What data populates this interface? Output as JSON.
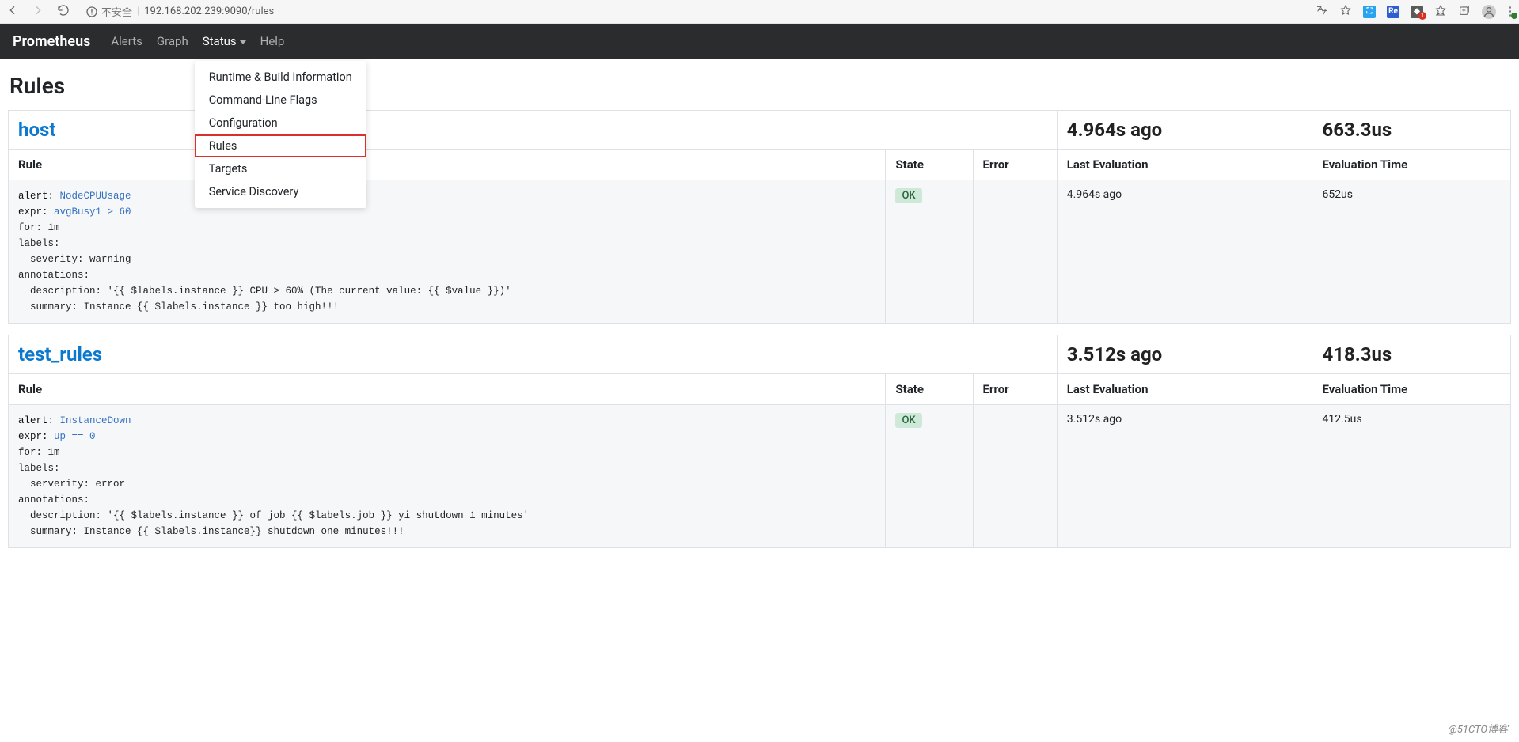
{
  "browser": {
    "insecure_label": "不安全",
    "url": "192.168.202.239:9090/rules"
  },
  "navbar": {
    "brand": "Prometheus",
    "items": {
      "alerts": "Alerts",
      "graph": "Graph",
      "status": "Status",
      "help": "Help"
    },
    "status_menu": {
      "runtime": "Runtime & Build Information",
      "flags": "Command-Line Flags",
      "configuration": "Configuration",
      "rules": "Rules",
      "targets": "Targets",
      "service_discovery": "Service Discovery"
    }
  },
  "page_title": "Rules",
  "columns": {
    "rule": "Rule",
    "state": "State",
    "error": "Error",
    "last_evaluation": "Last Evaluation",
    "evaluation_time": "Evaluation Time"
  },
  "groups": [
    {
      "name": "host",
      "last": "4.964s ago",
      "eval": "663.3us",
      "rules": [
        {
          "state": "OK",
          "error": "",
          "last": "4.964s ago",
          "eval": "652us",
          "code": {
            "alert_kw": "alert:",
            "alert_name": "NodeCPUUsage",
            "expr_kw": "expr:",
            "expr_body": "avgBusy1 > 60",
            "for_line": "for: 1m",
            "labels_line": "labels:",
            "labels_body": "  severity: warning",
            "annotations_line": "annotations:",
            "desc_line": "  description: '{{ $labels.instance }} CPU > 60% (The current value: {{ $value }})'",
            "summary_line": "  summary: Instance {{ $labels.instance }} too high!!!"
          }
        }
      ]
    },
    {
      "name": "test_rules",
      "last": "3.512s ago",
      "eval": "418.3us",
      "rules": [
        {
          "state": "OK",
          "error": "",
          "last": "3.512s ago",
          "eval": "412.5us",
          "code": {
            "alert_kw": "alert:",
            "alert_name": "InstanceDown",
            "expr_kw": "expr:",
            "expr_body": "up == 0",
            "for_line": "for: 1m",
            "labels_line": "labels:",
            "labels_body": "  serverity: error",
            "annotations_line": "annotations:",
            "desc_line": "  description: '{{ $labels.instance }} of job {{ $labels.job }} yi shutdown 1 minutes'",
            "summary_line": "  summary: Instance {{ $labels.instance}} shutdown one minutes!!!"
          }
        }
      ]
    }
  ],
  "watermark": "@51CTO博客"
}
